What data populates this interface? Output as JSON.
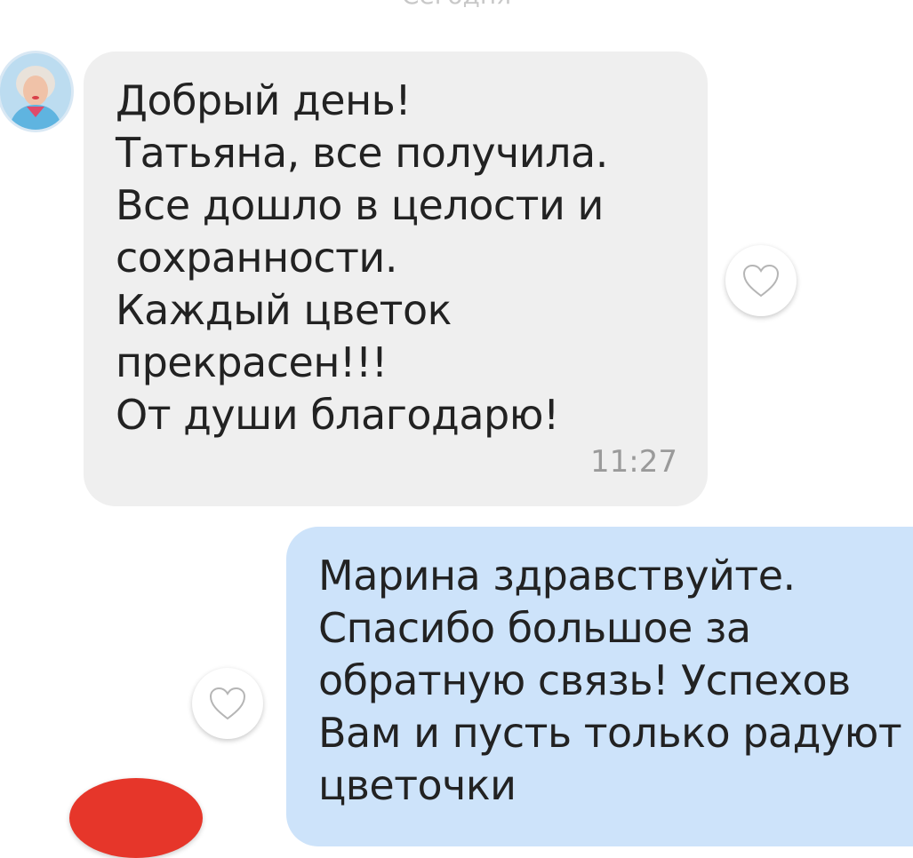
{
  "chat": {
    "date_separator": "Сегодня",
    "messages": [
      {
        "direction": "incoming",
        "text": "Добрый день!\nТатьяна, все получила.\nВсе дошло в целости и\nсохранности.\nКаждый цветок\nпрекрасен!!!\nОт души благодарю!",
        "time": "11:27",
        "like_icon": "heart-outline-icon"
      },
      {
        "direction": "outgoing",
        "text": "Марина здравствуйте.\nСпасибо большое за\nобратную связь! Успехов\nВам и пусть только радуют\nцветочки",
        "like_icon": "heart-outline-icon"
      }
    ]
  },
  "colors": {
    "incoming_bubble": "#efefef",
    "outgoing_bubble": "#cde3fa",
    "text": "#222222",
    "time": "#9a9a9a",
    "accent_red": "#e6362a"
  }
}
